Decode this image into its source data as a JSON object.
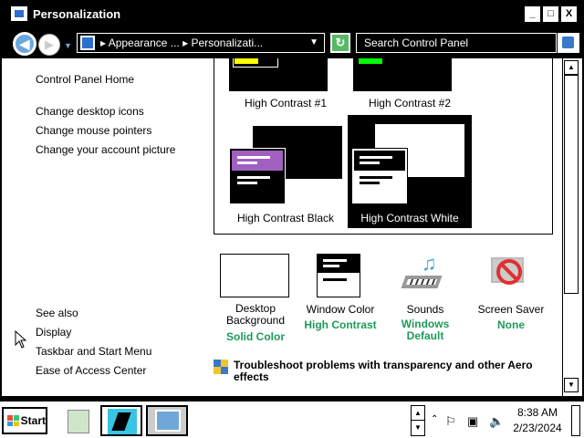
{
  "window": {
    "title": "Personalization",
    "buttons": {
      "minimize": "_",
      "maximize": "□",
      "close": "X"
    }
  },
  "address": {
    "crumbs": "▸ Appearance ... ▸ Personalizati...",
    "search_placeholder": "Search Control Panel"
  },
  "sidebar": {
    "home": "Control Panel Home",
    "links": [
      "Change desktop icons",
      "Change mouse pointers",
      "Change your account picture"
    ],
    "see_also_heading": "See also",
    "see_also": [
      "Display",
      "Taskbar and Start Menu",
      "Ease of Access Center"
    ]
  },
  "themes": [
    {
      "label": "High Contrast #1",
      "accent": "#ffff00",
      "selected": false
    },
    {
      "label": "High Contrast #2",
      "accent": "#00ff00",
      "selected": false
    },
    {
      "label": "High Contrast Black",
      "accent": "#a060c0",
      "selected": false
    },
    {
      "label": "High Contrast White",
      "accent": "#000000",
      "selected": true
    }
  ],
  "settings": [
    {
      "title": "Desktop Background",
      "value": "Solid Color",
      "icon": "desktop-background-icon"
    },
    {
      "title": "Window Color",
      "value": "High Contrast",
      "icon": "window-color-icon"
    },
    {
      "title": "Sounds",
      "value": "Windows Default",
      "icon": "sounds-icon"
    },
    {
      "title": "Screen Saver",
      "value": "None",
      "icon": "screen-saver-icon"
    }
  ],
  "troubleshoot": "Troubleshoot problems with transparency and other Aero effects",
  "taskbar": {
    "start_label": "Start",
    "time": "8:38 AM",
    "date": "2/23/2024"
  },
  "colors": {
    "value_green": "#1f9a5a",
    "link_black": "#000000"
  }
}
